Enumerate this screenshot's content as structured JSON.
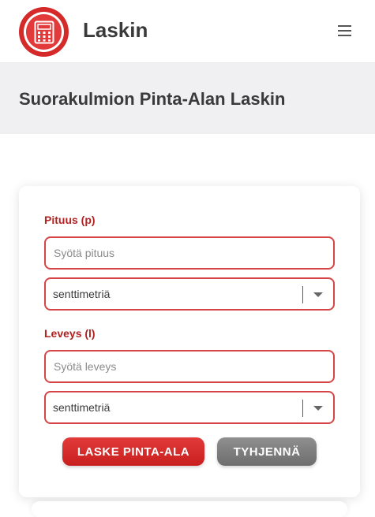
{
  "header": {
    "logo_icon": "calculator-icon",
    "site_title": "Laskin",
    "menu_icon": "hamburger-menu-icon"
  },
  "page": {
    "title": "Suorakulmion Pinta-Alan Laskin"
  },
  "form": {
    "length": {
      "label": "Pituus (p)",
      "placeholder": "Syötä pituus",
      "value": "",
      "unit": "senttimetriä"
    },
    "width": {
      "label": "Leveys (l)",
      "placeholder": "Syötä leveys",
      "value": "",
      "unit": "senttimetriä"
    },
    "calculate_label": "LASKE PINTA-ALA",
    "clear_label": "TYHJENNÄ"
  },
  "colors": {
    "accent": "#d42a2a",
    "label": "#b22222",
    "secondary_button": "#7d7d7d",
    "title_band": "#f0f0f2"
  }
}
